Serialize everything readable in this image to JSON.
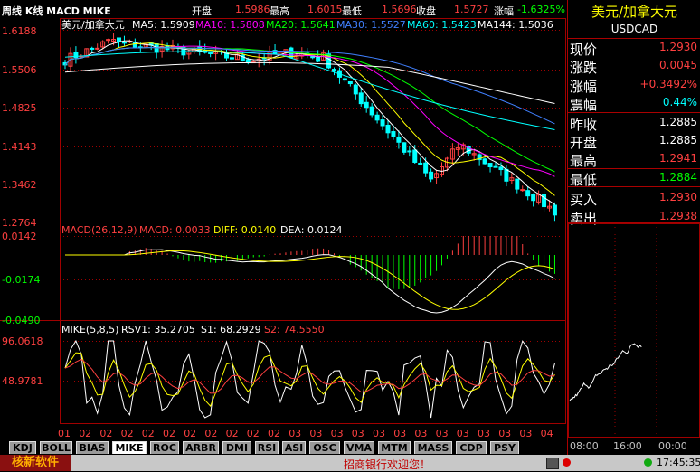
{
  "header": {
    "title": "周线 K线 MACD MIKE",
    "open_label": "开盘",
    "open": "1.5986",
    "high_label": "最高",
    "high": "1.6015",
    "low_label": "最低",
    "low": "1.5696",
    "close_label": "收盘",
    "close": "1.5727",
    "change_label": "涨幅",
    "change": "-1.6325%"
  },
  "kline": {
    "legend_name": "美元/加拿大元",
    "ma5": "MA5: 1.5909",
    "ma10": "MA10: 1.5808",
    "ma20": "MA20: 1.5641",
    "ma30": "MA30: 1.5527",
    "ma60": "MA60: 1.5423",
    "ma144": "MA144: 1.5036",
    "y_ticks": [
      "1.6188",
      "1.5506",
      "1.4825",
      "1.4143",
      "1.3462",
      "1.2764"
    ]
  },
  "macd": {
    "legend": "MACD(26,12,9)",
    "macd": "MACD: 0.0033",
    "diff": "DIFF: 0.0140",
    "dea": "DEA: 0.0124",
    "y_ticks": [
      "0.0142",
      "-0.0174",
      "-0.0490"
    ]
  },
  "mike": {
    "legend": "MIKE(5,8,5)",
    "rsv": "RSV1: 35.2705",
    "s1": "S1: 68.2929",
    "s2": "S2: 74.5550",
    "y_ticks": [
      "96.0618",
      "48.9781"
    ]
  },
  "x_ticks": [
    "01",
    "02",
    "02",
    "02",
    "02",
    "02",
    "02",
    "02",
    "02",
    "02",
    "02",
    "03",
    "03",
    "03",
    "03",
    "03",
    "03",
    "03",
    "03",
    "03",
    "03",
    "03",
    "03",
    "04"
  ],
  "tabs": [
    "KDJ",
    "BOLL",
    "BIAS",
    "MIKE",
    "ROC",
    "ARBR",
    "DMI",
    "RSI",
    "ASI",
    "OSC",
    "VMA",
    "MTM",
    "MASS",
    "CDP",
    "PSY"
  ],
  "active_tab": "MIKE",
  "quote": {
    "name": "美元/加拿大元",
    "code": "USDCAD",
    "rows": [
      {
        "label": "现价",
        "value": "1.2930",
        "color": "#ff4040"
      },
      {
        "label": "涨跌",
        "value": "0.0045",
        "color": "#ff4040"
      },
      {
        "label": "涨幅",
        "value": "+0.3492%",
        "color": "#ff4040"
      },
      {
        "label": "震幅",
        "value": "0.44%",
        "color": "#00ffff"
      },
      {
        "label": "昨收",
        "value": "1.2885",
        "color": "#ffffff"
      },
      {
        "label": "开盘",
        "value": "1.2885",
        "color": "#ffffff"
      },
      {
        "label": "最高",
        "value": "1.2941",
        "color": "#ff4040"
      },
      {
        "label": "最低",
        "value": "1.2884",
        "color": "#00ff00"
      },
      {
        "label": "买入",
        "value": "1.2930",
        "color": "#ff4040"
      },
      {
        "label": "卖出",
        "value": "1.2938",
        "color": "#ff4040"
      }
    ],
    "time_ticks": [
      "08:00",
      "16:00",
      "00:00"
    ]
  },
  "statusbar": {
    "app_name": "核新软件",
    "ticker": "招商银行欢迎您！",
    "clock": "17:45:35"
  },
  "colors": {
    "up": "#ff4040",
    "down": "#00ffff",
    "ma5": "#ffffff",
    "ma10": "#ffff00",
    "ma20": "#ff00ff",
    "ma30": "#00ff00",
    "ma60": "#4080ff",
    "ma144": "#00ffff",
    "grid": "#a00000"
  }
}
